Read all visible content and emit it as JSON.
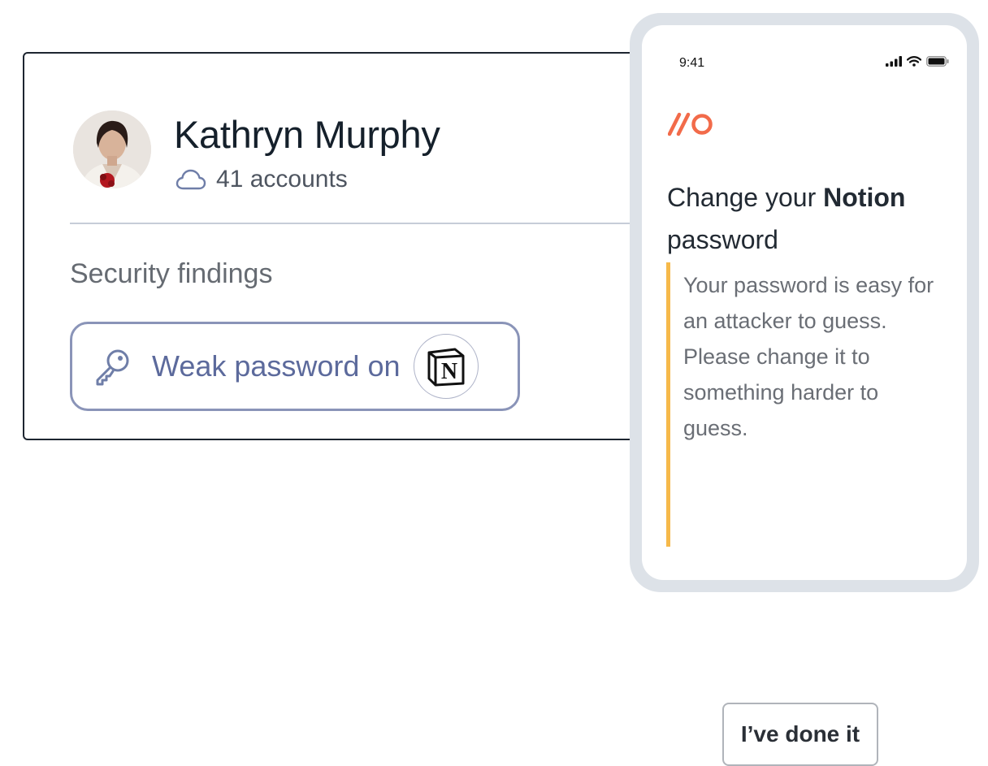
{
  "profile": {
    "name": "Kathryn Murphy",
    "accounts": "41 accounts",
    "accounts_icon": "cloud-icon"
  },
  "security": {
    "title": "Security findings",
    "finding": {
      "label": "Weak password on",
      "icon": "key-icon",
      "app_icon": "notion-logo",
      "app_letter": "N"
    }
  },
  "phone": {
    "status": {
      "time": "9:41",
      "icons": [
        "signal-icon",
        "wifi-icon",
        "battery-icon"
      ]
    },
    "logo_icon": "app-logo",
    "heading_prefix": "Change your ",
    "heading_app": "Notion",
    "heading_suffix": "password",
    "message": "Your password is easy for an attacker to guess. Please change it to something harder to guess.",
    "button_label": "I’ve done it"
  },
  "colors": {
    "accent_orange": "#f26b4a",
    "message_bar": "#f6b94a",
    "finding_border": "#8a94b8",
    "finding_text": "#5c6a9c"
  }
}
